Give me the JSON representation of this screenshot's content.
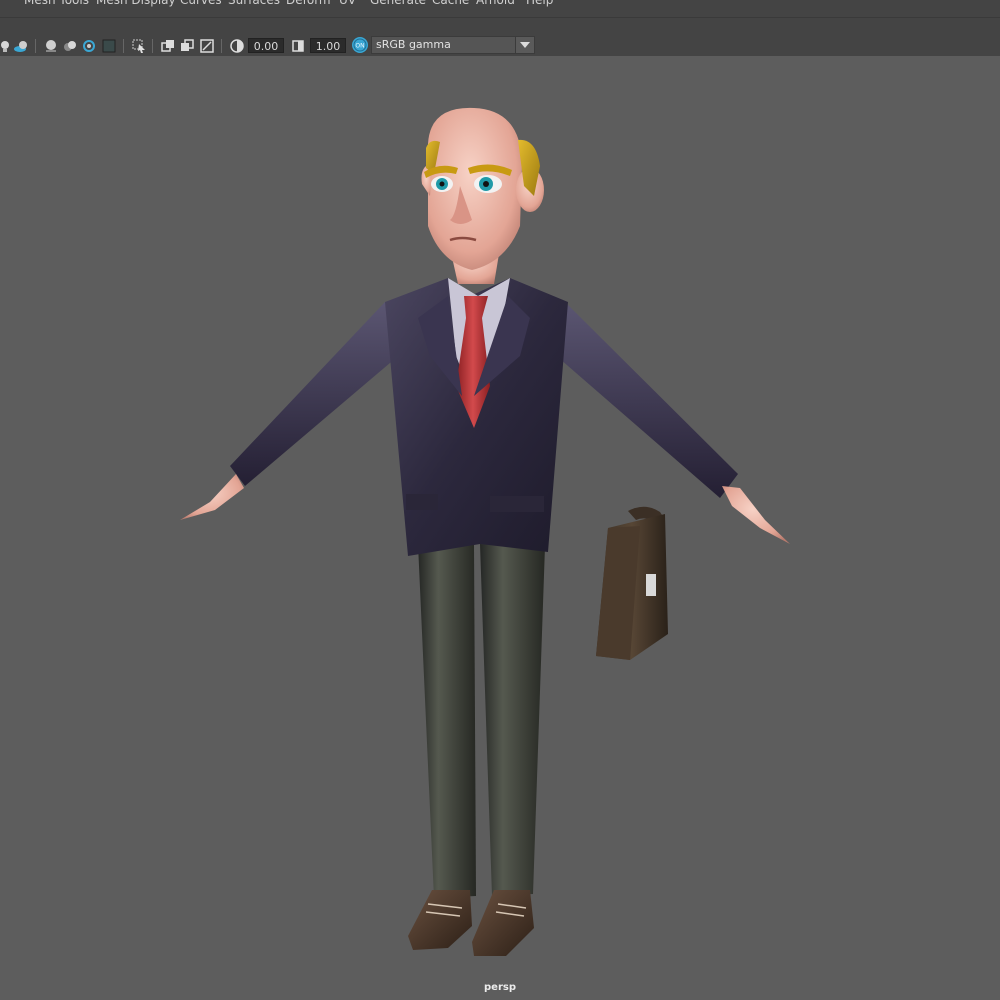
{
  "menubar": {
    "items": [
      {
        "name": "menu-mesh-tools",
        "label": "Mesh Tools"
      },
      {
        "name": "menu-mesh-display",
        "label": "Mesh Display"
      },
      {
        "name": "menu-curves",
        "label": "Curves"
      },
      {
        "name": "menu-surfaces",
        "label": "Surfaces"
      },
      {
        "name": "menu-deform",
        "label": "Deform"
      },
      {
        "name": "menu-uv",
        "label": "UV"
      },
      {
        "name": "menu-generate",
        "label": "Generate"
      },
      {
        "name": "menu-cache",
        "label": "Cache"
      },
      {
        "name": "menu-arnold",
        "label": "Arnold"
      },
      {
        "name": "menu-help",
        "label": "Help"
      }
    ]
  },
  "toolbar": {
    "exposure_value": "0.00",
    "gamma_value": "1.00",
    "color_management_label": "ON",
    "view_transform": "sRGB gamma"
  },
  "viewport": {
    "camera_name": "persp",
    "background_color": "#5d5d5d"
  },
  "colors": {
    "toolbar_bg": "#444444",
    "accent_cm": "#3aa7d4"
  }
}
